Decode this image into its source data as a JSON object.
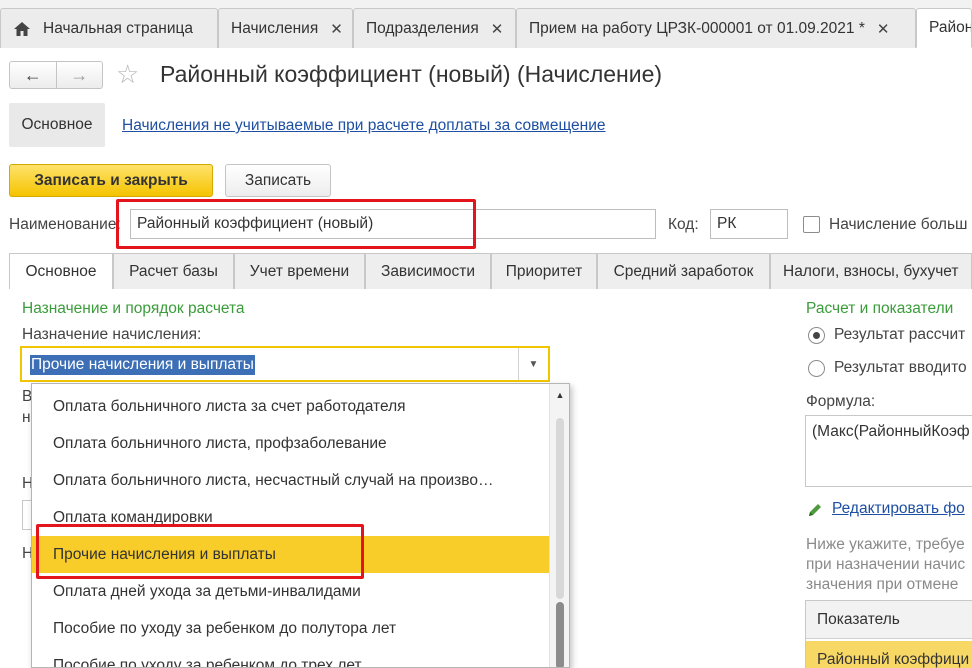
{
  "window_tabs": [
    {
      "label": "Начальная страница",
      "closable": false
    },
    {
      "label": "Начисления",
      "closable": true
    },
    {
      "label": "Подразделения",
      "closable": true
    },
    {
      "label": "Прием на работу ЦРЗК-000001 от 01.09.2021 *",
      "closable": true
    },
    {
      "label": "Районн",
      "closable": false
    }
  ],
  "nav": {
    "back": "←",
    "forward": "→",
    "favorite_icon": "star-icon"
  },
  "title": "Районный коэффициент (новый) (Начисление)",
  "panel": {
    "main_label": "Основное",
    "link": "Начисления не учитываемые при расчете доплаты за совмещение"
  },
  "commands": {
    "save_close": "Записать и закрыть",
    "save": "Записать"
  },
  "name_row": {
    "name_label": "Наименование:",
    "name_value": "Районный коэффициент (новый)",
    "code_label": "Код:",
    "code_value": "РК",
    "checkbox_label": "Начисление больш"
  },
  "form_tabs": [
    "Основное",
    "Расчет базы",
    "Учет времени",
    "Зависимости",
    "Приоритет",
    "Средний заработок",
    "Налоги, взносы, бухучет"
  ],
  "left": {
    "section_title": "Назначение и порядок расчета",
    "purpose_label": "Назначение начисления:",
    "purpose_value": "Прочие начисления и выплаты",
    "hidden_chars": [
      "В",
      "н",
      "Н",
      "Н"
    ]
  },
  "dropdown": {
    "items": [
      "Оплата больничного листа за счет работодателя",
      "Оплата больничного листа, профзаболевание",
      "Оплата больничного листа, несчастный случай на произво…",
      "Оплата командировки",
      "Прочие начисления и выплаты",
      "Оплата дней ухода за детьми-инвалидами",
      "Пособие по уходу за ребенком до полутора лет",
      "Пособие по уходу за ребенком до трех лет"
    ],
    "selected_index": 4,
    "highlight_color": "#f8cd2a"
  },
  "right": {
    "section_title": "Расчет и показатели",
    "radio1": "Результат рассчит",
    "radio2": "Результат вводито",
    "formula_label": "Формула:",
    "formula_value": "(Макс(РайонныйКоэф",
    "edit_link": "Редактировать фо",
    "hint_lines": [
      "Ниже укажите, требуе",
      "при назначении начис",
      "значения при отмене"
    ],
    "table_header": "Показатель",
    "table_row": "Районный коэффици"
  },
  "colors": {
    "accent_yellow": "#f4c400",
    "red_box": "#e3141b",
    "green_section": "#3a9c3a",
    "link_blue": "#1e4fa3"
  }
}
